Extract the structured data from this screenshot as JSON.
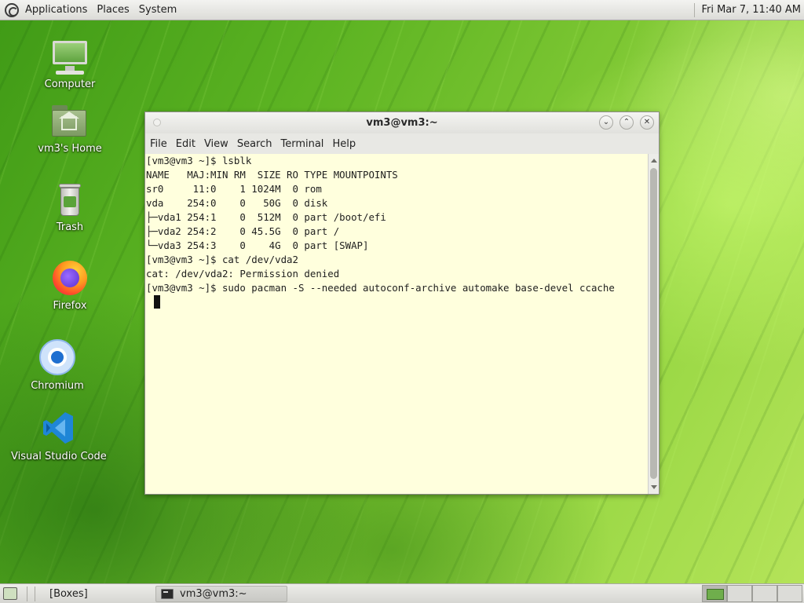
{
  "top_panel": {
    "menus": [
      "Applications",
      "Places",
      "System"
    ],
    "clock": "Fri Mar  7, 11:40 AM"
  },
  "desktop_icons": [
    {
      "label": "Computer",
      "icon": "computer-icon"
    },
    {
      "label": "vm3's Home",
      "icon": "home-folder-icon"
    },
    {
      "label": "Trash",
      "icon": "trash-icon"
    },
    {
      "label": "Firefox",
      "icon": "firefox-icon"
    },
    {
      "label": "Chromium",
      "icon": "chromium-icon"
    },
    {
      "label": "Visual Studio Code",
      "icon": "vscode-icon"
    }
  ],
  "terminal": {
    "title": "vm3@vm3:~",
    "menu": [
      "File",
      "Edit",
      "View",
      "Search",
      "Terminal",
      "Help"
    ],
    "lines": [
      "[vm3@vm3 ~]$ lsblk",
      "NAME   MAJ:MIN RM  SIZE RO TYPE MOUNTPOINTS",
      "sr0     11:0    1 1024M  0 rom",
      "vda    254:0    0   50G  0 disk",
      "├─vda1 254:1    0  512M  0 part /boot/efi",
      "├─vda2 254:2    0 45.5G  0 part /",
      "└─vda3 254:3    0    4G  0 part [SWAP]",
      "[vm3@vm3 ~]$ cat /dev/vda2",
      "cat: /dev/vda2: Permission denied",
      "[vm3@vm3 ~]$ sudo pacman -S --needed autoconf-archive automake base-devel ccache"
    ]
  },
  "bottom_panel": {
    "tasks": [
      "[Boxes]",
      "vm3@vm3:~"
    ]
  },
  "colors": {
    "terminal_bg": "#ffffdd",
    "panel_bg": "#e6e6e2",
    "desktop_green": "#6cbd2a"
  }
}
